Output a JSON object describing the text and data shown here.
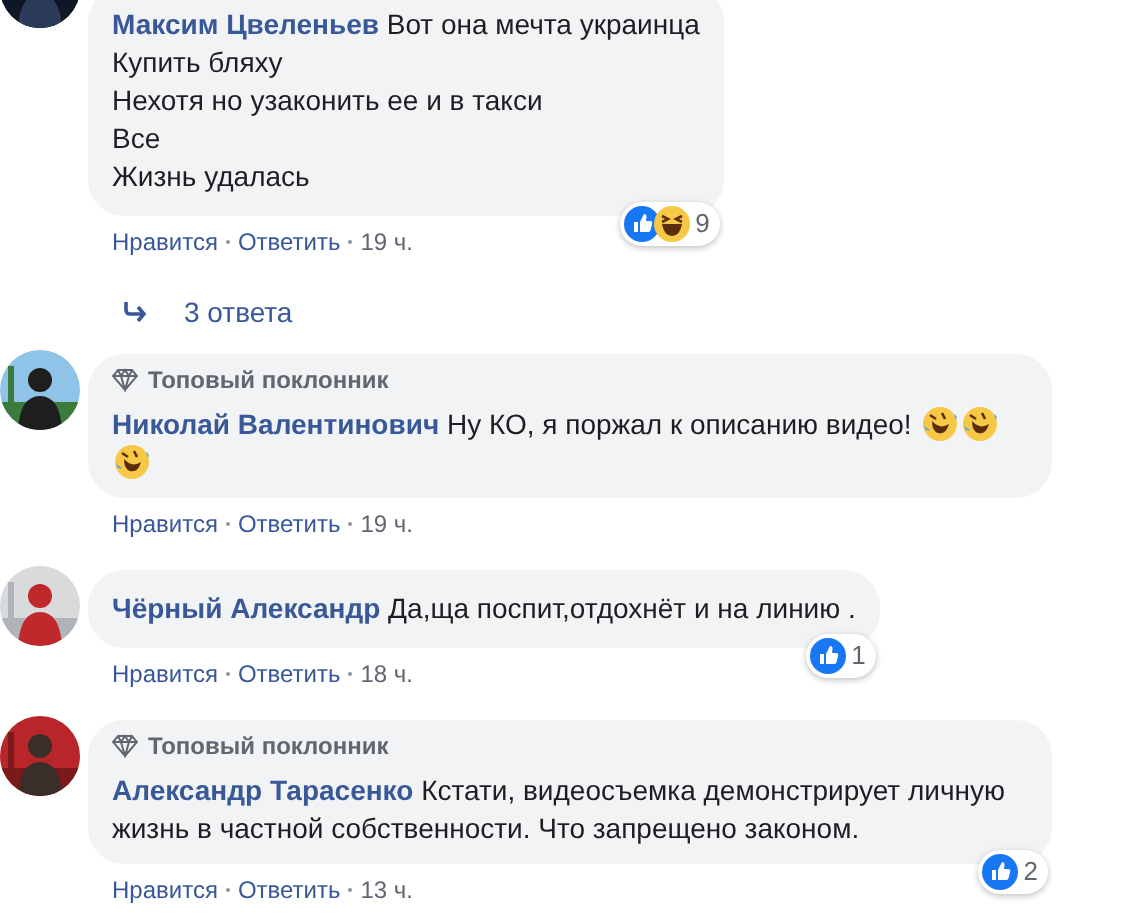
{
  "comments": [
    {
      "author": "Максим Цвеленьев",
      "lines": [
        "Вот она мечта украинца",
        "Купить бляху",
        "Нехотя но узаконить ее и в такси",
        "Все",
        "Жизнь удалась"
      ],
      "reactions": {
        "icons": [
          {
            "kind": "like"
          },
          {
            "kind": "haha"
          }
        ],
        "count": "9"
      },
      "actions": {
        "like": "Нравится",
        "reply": "Ответить",
        "time": "19 ч."
      },
      "replies": "3 ответа"
    },
    {
      "badge": "Топовый поклонник",
      "author": "Николай Валентинович",
      "lines": [
        "Ну КО, я поржал к описанию видео!"
      ],
      "emojis": [
        {
          "kind": "laughing"
        },
        {
          "kind": "laughing"
        },
        {
          "kind": "laughing"
        }
      ],
      "actions": {
        "like": "Нравится",
        "reply": "Ответить",
        "time": "19 ч."
      }
    },
    {
      "author": "Чёрный Александр",
      "lines": [
        "Да,ща поспит,отдохнёт и на линию ."
      ],
      "reactions": {
        "icons": [
          {
            "kind": "like"
          }
        ],
        "count": "1"
      },
      "actions": {
        "like": "Нравится",
        "reply": "Ответить",
        "time": "18 ч."
      }
    },
    {
      "badge": "Топовый поклонник",
      "author": "Александр Тарасенко",
      "lines": [
        "Кстати, видеосъемка демонстрирует личную жизнь в частной собственности. Что запрещено законом."
      ],
      "reactions": {
        "icons": [
          {
            "kind": "like"
          }
        ],
        "count": "2"
      },
      "actions": {
        "like": "Нравится",
        "reply": "Ответить",
        "time": "13 ч."
      }
    }
  ]
}
